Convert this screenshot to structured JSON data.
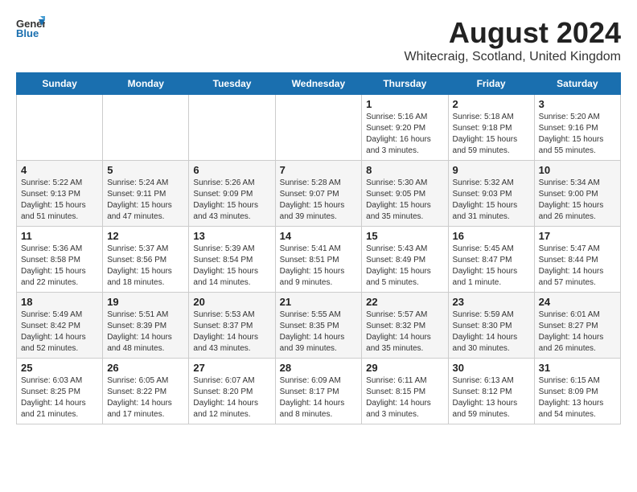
{
  "header": {
    "logo_general": "General",
    "logo_blue": "Blue",
    "main_title": "August 2024",
    "subtitle": "Whitecraig, Scotland, United Kingdom"
  },
  "calendar": {
    "days_of_week": [
      "Sunday",
      "Monday",
      "Tuesday",
      "Wednesday",
      "Thursday",
      "Friday",
      "Saturday"
    ],
    "weeks": [
      [
        {
          "day": "",
          "info": ""
        },
        {
          "day": "",
          "info": ""
        },
        {
          "day": "",
          "info": ""
        },
        {
          "day": "",
          "info": ""
        },
        {
          "day": "1",
          "info": "Sunrise: 5:16 AM\nSunset: 9:20 PM\nDaylight: 16 hours\nand 3 minutes."
        },
        {
          "day": "2",
          "info": "Sunrise: 5:18 AM\nSunset: 9:18 PM\nDaylight: 15 hours\nand 59 minutes."
        },
        {
          "day": "3",
          "info": "Sunrise: 5:20 AM\nSunset: 9:16 PM\nDaylight: 15 hours\nand 55 minutes."
        }
      ],
      [
        {
          "day": "4",
          "info": "Sunrise: 5:22 AM\nSunset: 9:13 PM\nDaylight: 15 hours\nand 51 minutes."
        },
        {
          "day": "5",
          "info": "Sunrise: 5:24 AM\nSunset: 9:11 PM\nDaylight: 15 hours\nand 47 minutes."
        },
        {
          "day": "6",
          "info": "Sunrise: 5:26 AM\nSunset: 9:09 PM\nDaylight: 15 hours\nand 43 minutes."
        },
        {
          "day": "7",
          "info": "Sunrise: 5:28 AM\nSunset: 9:07 PM\nDaylight: 15 hours\nand 39 minutes."
        },
        {
          "day": "8",
          "info": "Sunrise: 5:30 AM\nSunset: 9:05 PM\nDaylight: 15 hours\nand 35 minutes."
        },
        {
          "day": "9",
          "info": "Sunrise: 5:32 AM\nSunset: 9:03 PM\nDaylight: 15 hours\nand 31 minutes."
        },
        {
          "day": "10",
          "info": "Sunrise: 5:34 AM\nSunset: 9:00 PM\nDaylight: 15 hours\nand 26 minutes."
        }
      ],
      [
        {
          "day": "11",
          "info": "Sunrise: 5:36 AM\nSunset: 8:58 PM\nDaylight: 15 hours\nand 22 minutes."
        },
        {
          "day": "12",
          "info": "Sunrise: 5:37 AM\nSunset: 8:56 PM\nDaylight: 15 hours\nand 18 minutes."
        },
        {
          "day": "13",
          "info": "Sunrise: 5:39 AM\nSunset: 8:54 PM\nDaylight: 15 hours\nand 14 minutes."
        },
        {
          "day": "14",
          "info": "Sunrise: 5:41 AM\nSunset: 8:51 PM\nDaylight: 15 hours\nand 9 minutes."
        },
        {
          "day": "15",
          "info": "Sunrise: 5:43 AM\nSunset: 8:49 PM\nDaylight: 15 hours\nand 5 minutes."
        },
        {
          "day": "16",
          "info": "Sunrise: 5:45 AM\nSunset: 8:47 PM\nDaylight: 15 hours\nand 1 minute."
        },
        {
          "day": "17",
          "info": "Sunrise: 5:47 AM\nSunset: 8:44 PM\nDaylight: 14 hours\nand 57 minutes."
        }
      ],
      [
        {
          "day": "18",
          "info": "Sunrise: 5:49 AM\nSunset: 8:42 PM\nDaylight: 14 hours\nand 52 minutes."
        },
        {
          "day": "19",
          "info": "Sunrise: 5:51 AM\nSunset: 8:39 PM\nDaylight: 14 hours\nand 48 minutes."
        },
        {
          "day": "20",
          "info": "Sunrise: 5:53 AM\nSunset: 8:37 PM\nDaylight: 14 hours\nand 43 minutes."
        },
        {
          "day": "21",
          "info": "Sunrise: 5:55 AM\nSunset: 8:35 PM\nDaylight: 14 hours\nand 39 minutes."
        },
        {
          "day": "22",
          "info": "Sunrise: 5:57 AM\nSunset: 8:32 PM\nDaylight: 14 hours\nand 35 minutes."
        },
        {
          "day": "23",
          "info": "Sunrise: 5:59 AM\nSunset: 8:30 PM\nDaylight: 14 hours\nand 30 minutes."
        },
        {
          "day": "24",
          "info": "Sunrise: 6:01 AM\nSunset: 8:27 PM\nDaylight: 14 hours\nand 26 minutes."
        }
      ],
      [
        {
          "day": "25",
          "info": "Sunrise: 6:03 AM\nSunset: 8:25 PM\nDaylight: 14 hours\nand 21 minutes."
        },
        {
          "day": "26",
          "info": "Sunrise: 6:05 AM\nSunset: 8:22 PM\nDaylight: 14 hours\nand 17 minutes."
        },
        {
          "day": "27",
          "info": "Sunrise: 6:07 AM\nSunset: 8:20 PM\nDaylight: 14 hours\nand 12 minutes."
        },
        {
          "day": "28",
          "info": "Sunrise: 6:09 AM\nSunset: 8:17 PM\nDaylight: 14 hours\nand 8 minutes."
        },
        {
          "day": "29",
          "info": "Sunrise: 6:11 AM\nSunset: 8:15 PM\nDaylight: 14 hours\nand 3 minutes."
        },
        {
          "day": "30",
          "info": "Sunrise: 6:13 AM\nSunset: 8:12 PM\nDaylight: 13 hours\nand 59 minutes."
        },
        {
          "day": "31",
          "info": "Sunrise: 6:15 AM\nSunset: 8:09 PM\nDaylight: 13 hours\nand 54 minutes."
        }
      ]
    ]
  }
}
